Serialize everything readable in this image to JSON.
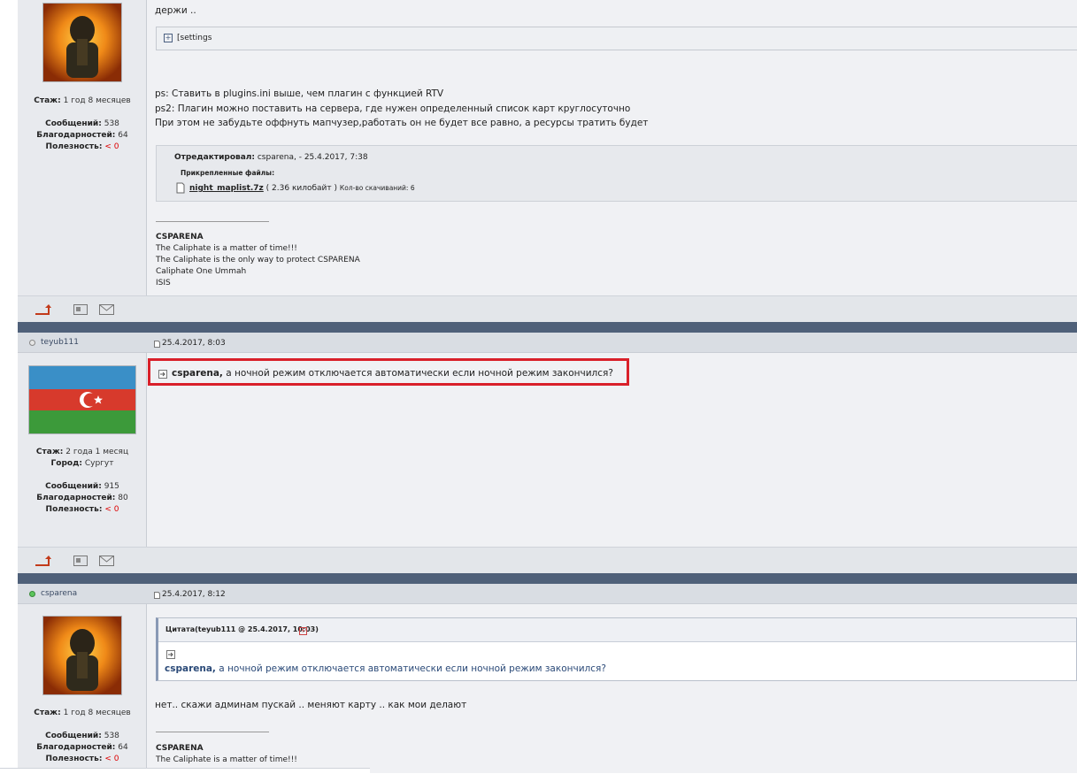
{
  "post1": {
    "stats": {
      "stage_label": "Стаж:",
      "stage_value": "1 год 8 месяцев",
      "messages_label": "Сообщений:",
      "messages_value": "538",
      "thanks_label": "Благодарностей:",
      "thanks_value": "64",
      "useful_label": "Полезность:",
      "useful_value": "< 0"
    },
    "lines": {
      "l1": "держи ..",
      "spoiler": "[settings",
      "ps1": "ps: Ставить в plugins.ini выше, чем плагин с функцией RTV",
      "ps2": "ps2: Плагин можно поставить на сервера, где нужен определенный список карт круглосуточно",
      "ps3": "При этом не забудьте оффнуть мапчузер,работать он не будет все равно, а ресурсы тратить будет"
    },
    "edit": {
      "edited_label": "Отредактировал:",
      "edited_value": "csparena, - 25.4.2017, 7:38",
      "attach_label": "Прикрепленные файлы:",
      "file_name": "night_maplist.7z",
      "file_size": "( 2.36 килобайт )",
      "downloads": "Кол-во скачиваний: 6"
    },
    "signature": {
      "s1": "CSPARENA",
      "s2": "The Caliphate is a matter of time!!!",
      "s3": "The Caliphate is the only way to protect CSPARENA",
      "s4": "Caliphate One Ummah",
      "s5": "ISIS"
    }
  },
  "post2": {
    "username": "teyub111",
    "date": "25.4.2017, 8:03",
    "stats": {
      "stage_label": "Стаж:",
      "stage_value": "2 года 1 месяц",
      "city_label": "Город:",
      "city_value": "Сургут",
      "messages_label": "Сообщений:",
      "messages_value": "915",
      "thanks_label": "Благодарностей:",
      "thanks_value": "80",
      "useful_label": "Полезность:",
      "useful_value": "< 0"
    },
    "mention": "csparena,",
    "message": " а ночной режим отключается автоматически если ночной режим закончился?"
  },
  "post3": {
    "username": "csparena",
    "date": "25.4.2017, 8:12",
    "quote_header": "Цитата(teyub111 @ 25.4.2017, 10:03)",
    "quote_mention": "csparena,",
    "quote_text": " а ночной режим отключается автоматически если ночной режим закончился?",
    "message": "нет.. скажи админам пускай .. меняют карту .. как мои делают",
    "stats": {
      "stage_label": "Стаж:",
      "stage_value": "1 год 8 месяцев",
      "messages_label": "Сообщений:",
      "messages_value": "538",
      "thanks_label": "Благодарностей:",
      "thanks_value": "64",
      "useful_label": "Полезность:",
      "useful_value": "< 0"
    },
    "signature": {
      "s1": "CSPARENA",
      "s2": "The Caliphate is a matter of time!!!"
    }
  },
  "colors": {
    "highlight": "#d9202a",
    "separator": "#4f6079",
    "link": "#2b4a78"
  }
}
